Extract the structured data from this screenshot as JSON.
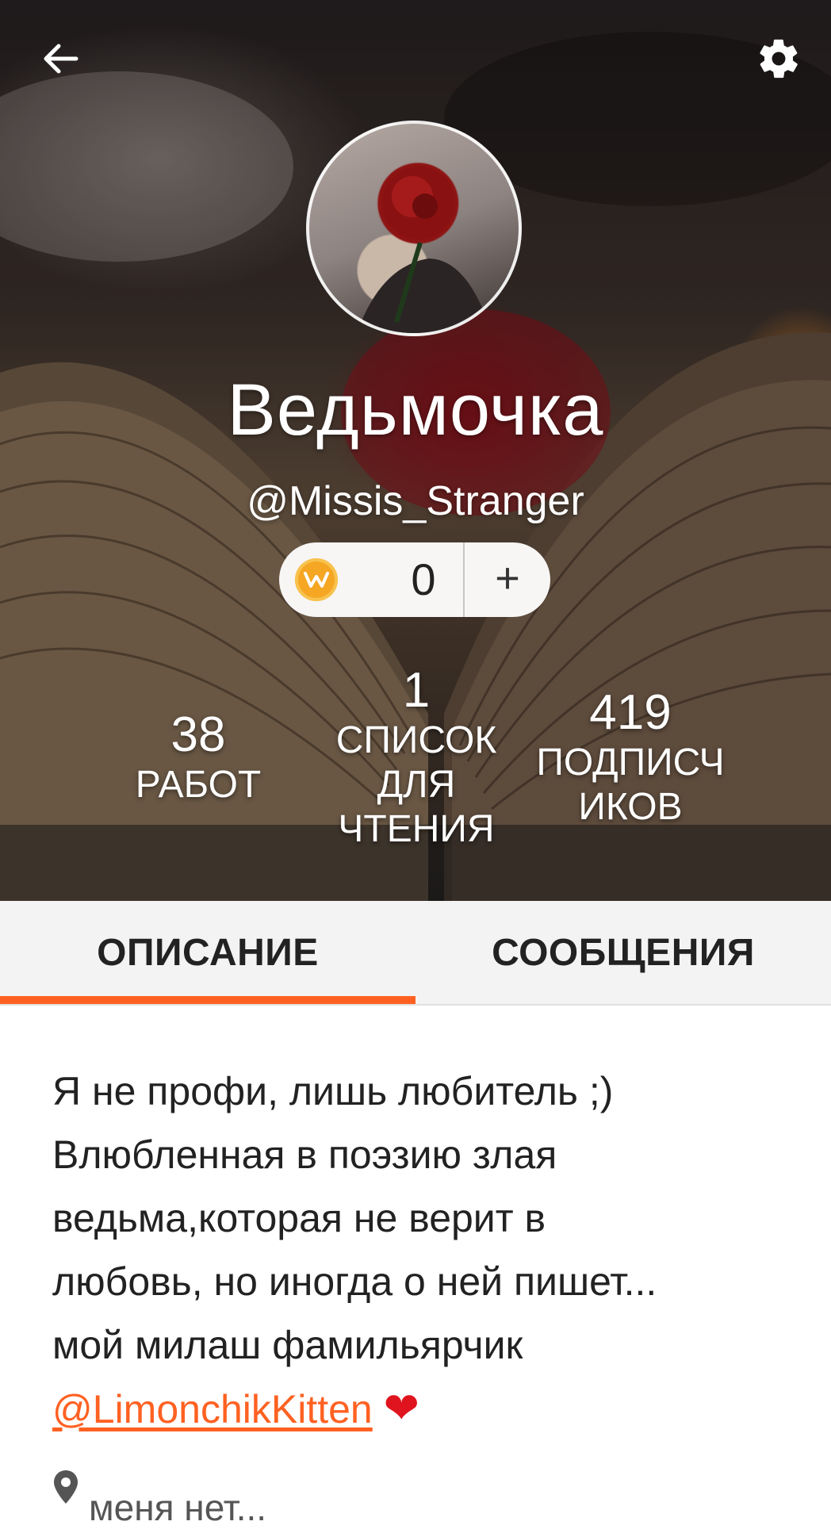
{
  "profile": {
    "display_name": "Ведьмочка",
    "username": "@Missis_Stranger",
    "coins": {
      "count": "0",
      "add_label": "+"
    },
    "stats": {
      "works": {
        "value": "38",
        "label": "РАБОТ"
      },
      "reading_lists": {
        "value": "1",
        "label_lines": [
          "СПИСОК",
          "ДЛЯ",
          "ЧТЕНИЯ"
        ]
      },
      "followers": {
        "value": "419",
        "label_lines": [
          "ПОДПИСЧ",
          "ИКОВ"
        ]
      }
    }
  },
  "icons": {
    "back": "back-arrow-icon",
    "settings": "gear-icon",
    "coin": "coin-icon",
    "location": "location-pin-icon",
    "heart": "heart-icon"
  },
  "tabs": [
    {
      "label": "ОПИСАНИЕ",
      "active": true
    },
    {
      "label": "СООБЩЕНИЯ",
      "active": false
    }
  ],
  "bio": {
    "lines": [
      "Я не профи, лишь любитель ;)",
      "Влюбленная в поэзию злая",
      "ведьма,которая не верит в",
      "любовь, но иногда о ней пишет...",
      "мой милаш фамильярчик"
    ],
    "mention": "@LimonchikKitten",
    "emoji": "❤"
  },
  "location": "меня нет...",
  "colors": {
    "accent": "#ff6122",
    "coin": "#f5a623",
    "heart": "#e0141e"
  }
}
